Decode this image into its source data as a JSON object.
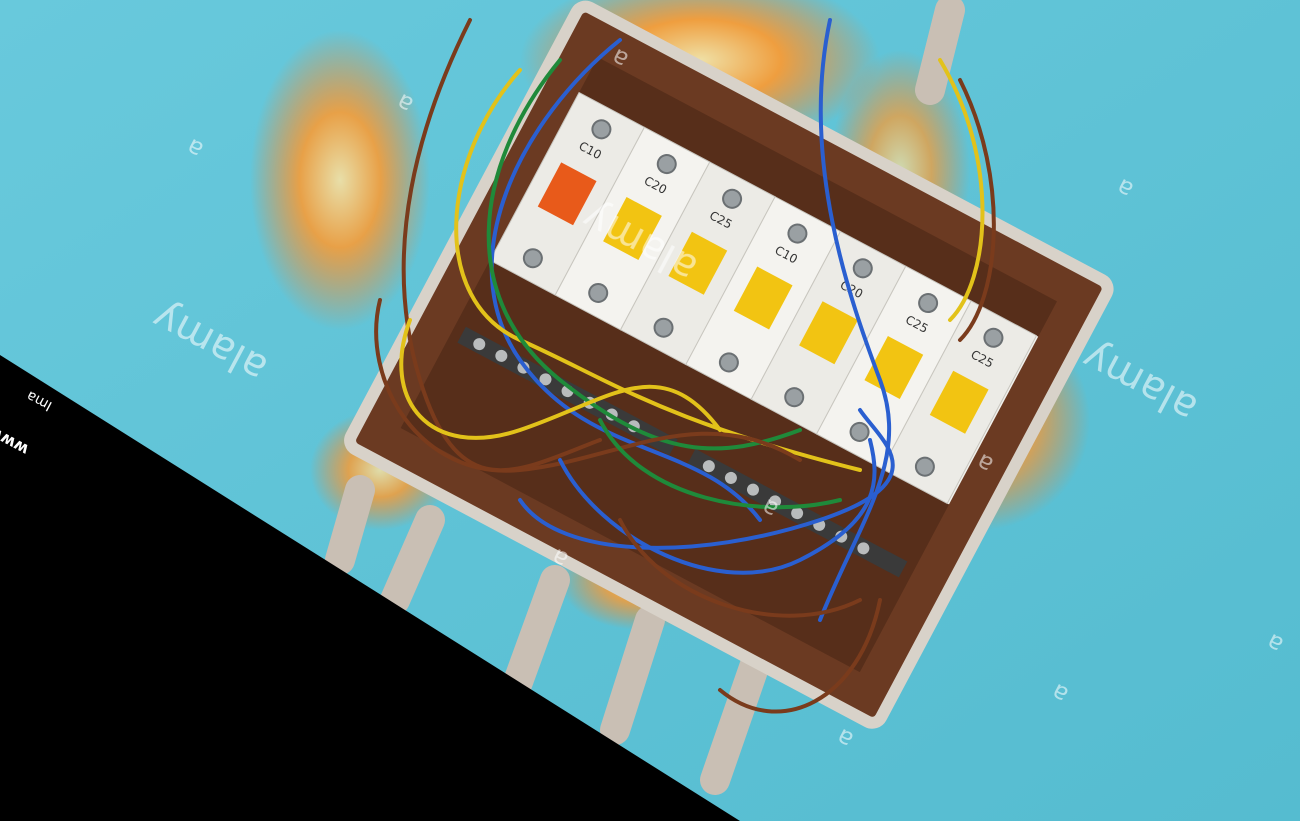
{
  "scene": {
    "subject": "burning-electrical-breaker-panel",
    "background_color": "#5fc3d6",
    "banner_color": "#000000",
    "flame_colors": [
      "#ff7b1c",
      "#ffb347",
      "#ffd27a",
      "#d94a0b"
    ],
    "wire_colors": [
      "#7a3b1c",
      "#2a5fd0",
      "#e2c21a",
      "#1f8a3a"
    ]
  },
  "watermark": {
    "brand": "alamy",
    "mark": "a"
  },
  "breakers": [
    {
      "label": "C10",
      "handle_color": "#e85a1a"
    },
    {
      "label": "C20",
      "handle_color": "#f2c412"
    },
    {
      "label": "C25",
      "handle_color": "#f2c412"
    },
    {
      "label": "C10",
      "handle_color": "#f2c412"
    },
    {
      "label": "C20",
      "handle_color": "#f2c412"
    },
    {
      "label": "C25",
      "handle_color": "#f2c412"
    },
    {
      "label": "C25",
      "handle_color": "#f2c412"
    }
  ],
  "banner": {
    "line1": "Ima",
    "line2": "www"
  }
}
